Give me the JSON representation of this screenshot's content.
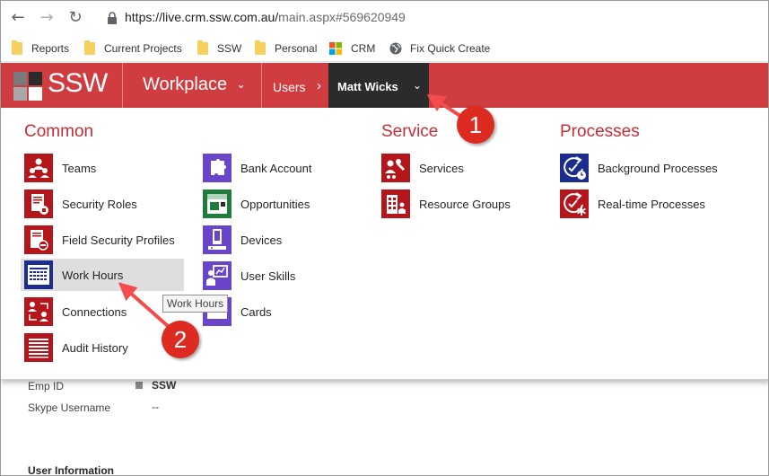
{
  "browser": {
    "url_base": "https://live.crm.ssw.com.au/",
    "url_path": "main.aspx#569620949",
    "bookmarks": [
      {
        "label": "Reports",
        "icon": "folder-icon"
      },
      {
        "label": "Current Projects",
        "icon": "folder-icon"
      },
      {
        "label": "SSW",
        "icon": "folder-icon"
      },
      {
        "label": "Personal",
        "icon": "folder-icon"
      },
      {
        "label": "CRM",
        "icon": "microsoft-icon"
      },
      {
        "label": "Fix Quick Create",
        "icon": "globe-icon"
      }
    ]
  },
  "navbar": {
    "logo_text": "SSW",
    "area": "Workplace",
    "breadcrumb": "Users",
    "record": "Matt Wicks"
  },
  "menu": {
    "common_title": "Common",
    "service_title": "Service",
    "processes_title": "Processes",
    "common_col1": [
      "Teams",
      "Security Roles",
      "Field Security Profiles",
      "Work Hours",
      "Connections",
      "Audit History"
    ],
    "common_col2": [
      "Bank Account",
      "Opportunities",
      "Devices",
      "User Skills",
      "Cards"
    ],
    "service": [
      "Services",
      "Resource Groups"
    ],
    "processes": [
      "Background Processes",
      "Real-time Processes"
    ],
    "tooltip": "Work Hours"
  },
  "form": {
    "emp_id_label": "Emp ID",
    "emp_id_value": "SSW",
    "skype_label": "Skype Username",
    "skype_value": "--",
    "section_title": "User Information"
  },
  "annotations": [
    "1",
    "2"
  ],
  "colors": {
    "navbar": "#d03d40",
    "record_tab": "#2b2b2b",
    "group_title": "#c52e34",
    "icon_red": "#b5161c",
    "icon_green": "#1e7d3a",
    "icon_purple": "#6b45c9",
    "icon_navy": "#1d2d8f",
    "callout": "#de2b22"
  }
}
